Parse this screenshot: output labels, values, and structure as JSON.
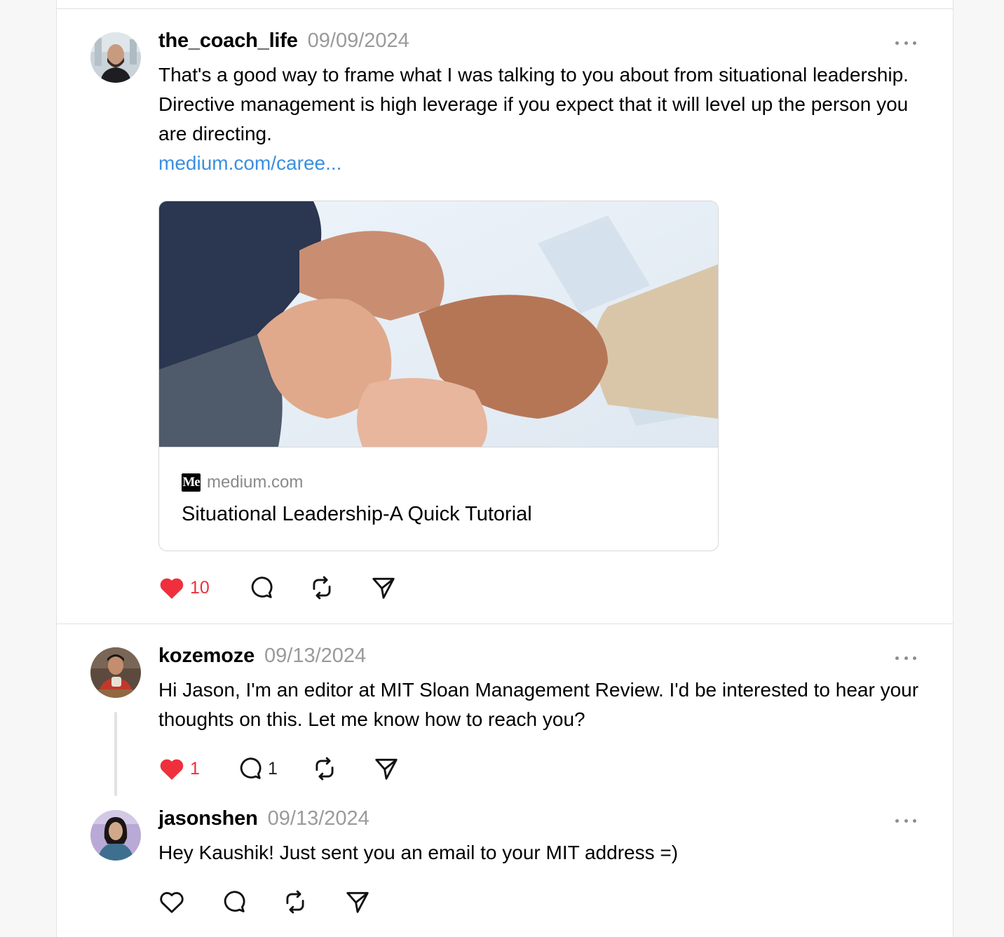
{
  "posts": [
    {
      "username": "the_coach_life",
      "date": "09/09/2024",
      "text": "That's a good way to frame what I was talking to you about from situational leadership. Directive management is high leverage if you expect that it will level up the person you are directing.",
      "link_text": "medium.com/caree...",
      "card": {
        "favicon": "Me",
        "source": "medium.com",
        "title": "Situational Leadership-A Quick Tutorial"
      },
      "likes": "10",
      "liked": true
    },
    {
      "username": "kozemoze",
      "date": "09/13/2024",
      "text": "Hi Jason, I'm an editor at MIT Sloan Management Review. I'd be interested to hear your thoughts on this. Let me know how to reach you?",
      "likes": "1",
      "replies": "1",
      "liked": true
    },
    {
      "username": "jasonshen",
      "date": "09/13/2024",
      "text": "Hey Kaushik! Just sent you an email to your MIT address =)",
      "liked": false
    }
  ],
  "icons": {
    "like": "heart-icon",
    "reply": "comment-bubble-icon",
    "repost": "repost-icon",
    "share": "send-icon",
    "more": "more-dots-icon"
  },
  "colors": {
    "liked": "#ef2f3c",
    "link": "#3b8fe0",
    "meta": "#9a9a9a"
  }
}
